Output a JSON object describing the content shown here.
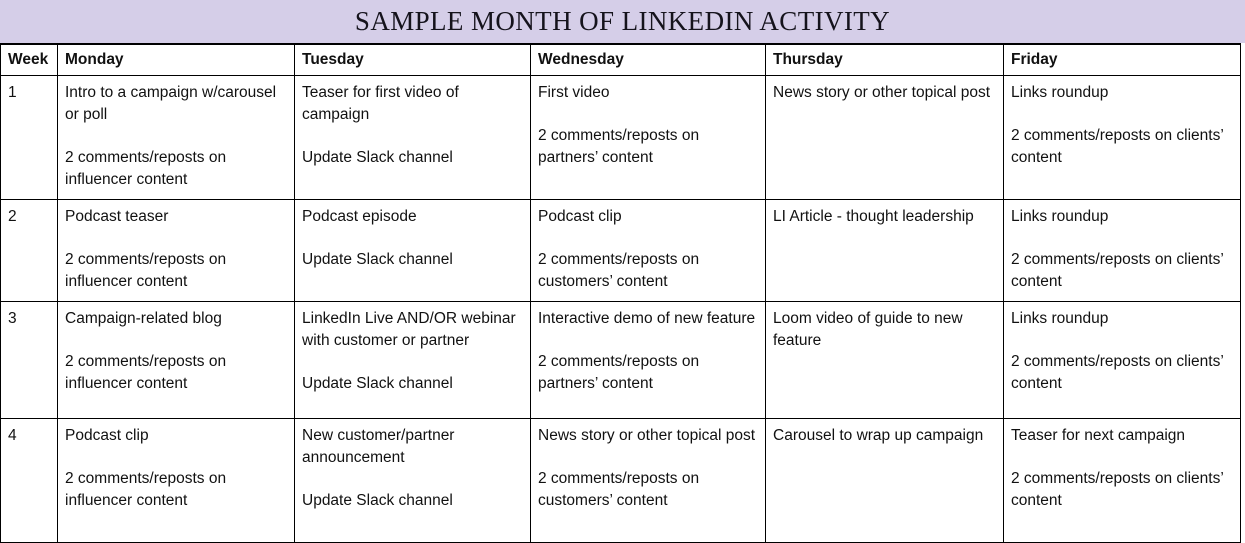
{
  "banner": {
    "title": "SAMPLE MONTH OF LINKEDIN ACTIVITY",
    "background_color": "#D5CEE8",
    "text_color": "#15131C"
  },
  "table": {
    "headers": {
      "week": "Week",
      "monday": "Monday",
      "tuesday": "Tuesday",
      "wednesday": "Wednesday",
      "thursday": "Thursday",
      "friday": "Friday"
    },
    "rows": [
      {
        "week": "1",
        "monday": {
          "primary": "Intro to a campaign w/carousel or poll",
          "secondary": "2 comments/reposts on influencer content"
        },
        "tuesday": {
          "primary": "Teaser for first video of campaign",
          "secondary": "Update Slack channel"
        },
        "wednesday": {
          "primary": "First video",
          "secondary": "2 comments/reposts on partners’ content"
        },
        "thursday": {
          "primary": "News story or other topical post",
          "secondary": ""
        },
        "friday": {
          "primary": "Links roundup",
          "secondary": "2 comments/reposts on clients’ content"
        }
      },
      {
        "week": "2",
        "monday": {
          "primary": "Podcast teaser",
          "secondary": "2 comments/reposts on influencer content"
        },
        "tuesday": {
          "primary": "Podcast episode",
          "secondary": "Update Slack channel"
        },
        "wednesday": {
          "primary": "Podcast clip",
          "secondary": "2 comments/reposts on customers’ content"
        },
        "thursday": {
          "primary": "LI Article - thought leadership",
          "secondary": ""
        },
        "friday": {
          "primary": "Links roundup",
          "secondary": "2 comments/reposts on clients’ content"
        }
      },
      {
        "week": "3",
        "monday": {
          "primary": "Campaign-related blog",
          "secondary": "2 comments/reposts on influencer content"
        },
        "tuesday": {
          "primary": "LinkedIn Live AND/OR webinar with customer or partner",
          "secondary": "Update Slack channel"
        },
        "wednesday": {
          "primary": "Interactive demo of new feature",
          "secondary": "2 comments/reposts on partners’ content"
        },
        "thursday": {
          "primary": "Loom video of guide to new feature",
          "secondary": ""
        },
        "friday": {
          "primary": "Links roundup",
          "secondary": "2 comments/reposts on clients’ content"
        }
      },
      {
        "week": "4",
        "monday": {
          "primary": "Podcast clip",
          "secondary": "2 comments/reposts on influencer content"
        },
        "tuesday": {
          "primary": "New customer/partner announcement",
          "secondary": "Update Slack channel"
        },
        "wednesday": {
          "primary": "News story or other topical post",
          "secondary": "2 comments/reposts on customers’ content"
        },
        "thursday": {
          "primary": "Carousel to wrap up campaign",
          "secondary": ""
        },
        "friday": {
          "primary": "Teaser for next campaign",
          "secondary": "2 comments/reposts on clients’ content"
        }
      }
    ]
  }
}
